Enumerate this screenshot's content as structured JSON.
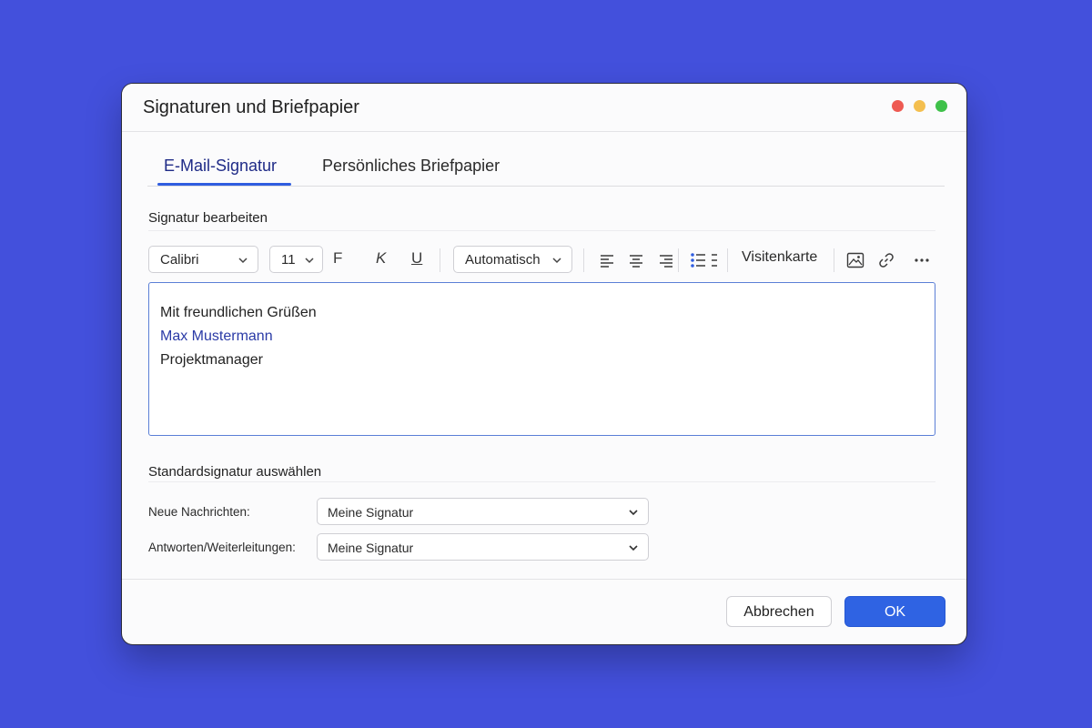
{
  "window": {
    "title": "Signaturen und Briefpapier"
  },
  "tabs": [
    {
      "label": "E-Mail-Signatur",
      "active": true
    },
    {
      "label": "Persönliches Briefpapier",
      "active": false
    }
  ],
  "editor_section": {
    "title": "Signatur bearbeiten",
    "toolbar": {
      "font": "Calibri",
      "size": "11",
      "bold": "F",
      "italic": "K",
      "underline": "U",
      "color": "Automatisch",
      "business_card": "Visitenkarte",
      "icons": [
        "align-left-icon",
        "align-center-icon",
        "align-right-icon",
        "list-icon",
        "image-icon",
        "link-icon",
        "more-icon"
      ]
    },
    "content": {
      "line1": "Mit freundlichen Grüßen",
      "line2": "Max Mustermann",
      "line3": "Projektmanager",
      "name_color": "#2a3aa6"
    }
  },
  "default_section": {
    "title": "Standardsignatur auswählen",
    "new_messages": {
      "label": "Neue Nachrichten:",
      "value": "Meine Signatur"
    },
    "replies": {
      "label": "Antworten/Weiterleitungen:",
      "value": "Meine Signatur"
    }
  },
  "buttons": {
    "cancel": "Abbrechen",
    "ok": "OK"
  },
  "colors": {
    "background": "#4350dc",
    "accent": "#2f63e3"
  }
}
